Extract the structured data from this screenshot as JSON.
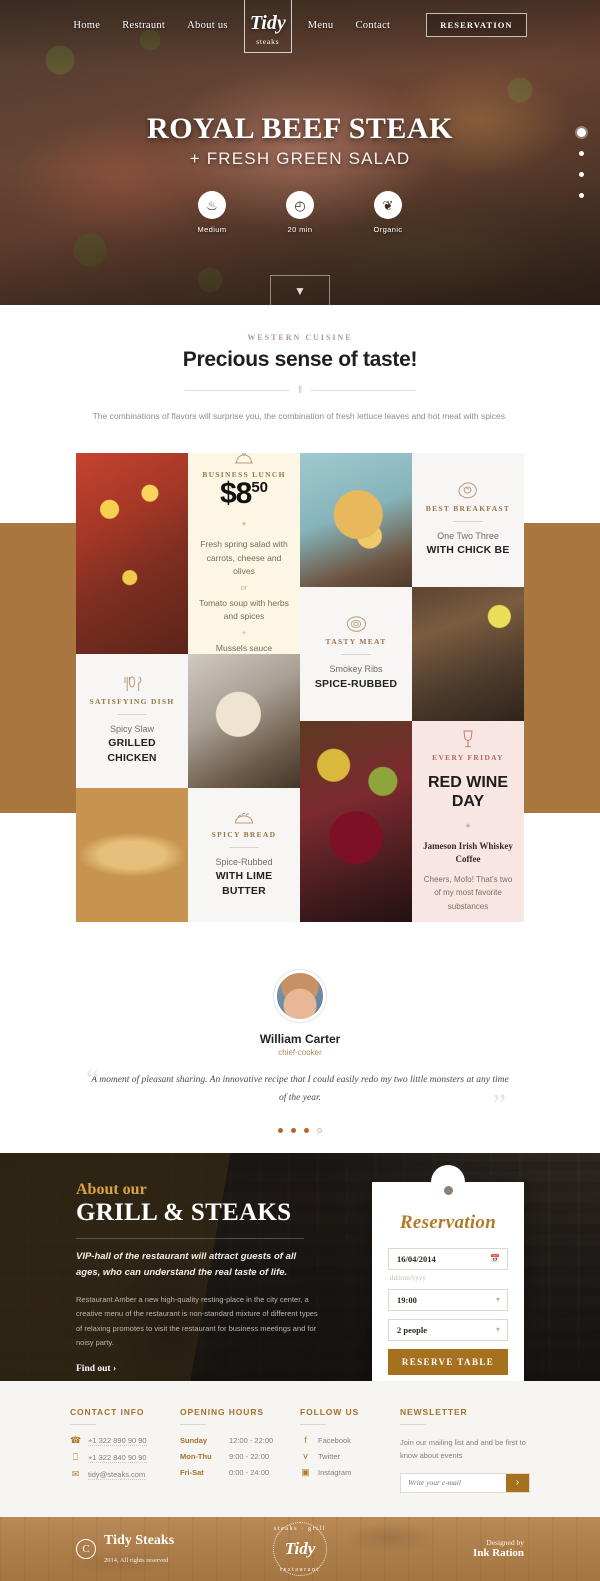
{
  "nav": {
    "left_links": [
      {
        "label": "Home"
      },
      {
        "label": "Restraunt"
      },
      {
        "label": "About us"
      }
    ],
    "right_links": [
      {
        "label": "Menu"
      },
      {
        "label": "Contact"
      }
    ],
    "logo_mark": "Tidy",
    "logo_sub": "steaks",
    "reservation_button": "RESERVATION"
  },
  "hero": {
    "title": "ROYAL BEEF STEAK",
    "subtitle": "+ FRESH GREEN SALAD",
    "features": [
      {
        "icon": "flame-icon",
        "glyph": "♨",
        "label": "Medium"
      },
      {
        "icon": "clock-icon",
        "glyph": "◴",
        "label": "20 min"
      },
      {
        "icon": "leaf-icon",
        "glyph": "❦",
        "label": "Organic"
      }
    ],
    "slider_dots": 4,
    "active_dot": 1,
    "scroll_icon": "chevron-down-icon"
  },
  "intro": {
    "eyebrow": "WESTERN CUISINE",
    "heading": "Precious sense of taste!",
    "divider_glyph": "‖",
    "paragraph": "The combinations of flavors will surprise you, the combination of fresh lettuce leaves and hot meat with spices."
  },
  "menu_tiles": {
    "business_lunch": {
      "icon": "cloche-icon",
      "kicker": "BUSINESS LUNCH",
      "price_main": "$8",
      "price_cents": "50",
      "line1": "Fresh spring salad with carrots, cheese and olives",
      "sep1": "or",
      "line2": "Tomato soup with herbs and spices",
      "sep2": "+",
      "line3": "Mussels sauce"
    },
    "best_breakfast": {
      "icon": "fried-egg-icon",
      "kicker": "BEST BREAKFAST",
      "line1": "One Two Three",
      "line2": "WITH CHICK BE"
    },
    "tasty_meat": {
      "icon": "steak-icon",
      "kicker": "TASTY MEAT",
      "line1": "Smokey Ribs",
      "line2": "SPICE-RUBBED"
    },
    "satisfying_dish": {
      "icon": "cutlery-icon",
      "kicker": "SATISFYING DISH",
      "line1": "Spicy Slaw",
      "line2": "GRILLED CHICKEN"
    },
    "spicy_bread": {
      "icon": "bread-icon",
      "kicker": "SPICY BREAD",
      "line1": "Spice-Rubbed",
      "line2": "WITH LIME BUTTER"
    },
    "red_wine_day": {
      "icon": "wine-glass-icon",
      "kicker": "EVERY FRIDAY",
      "title": "RED WINE DAY",
      "sub": "Jameson Irish Whiskey Coffee",
      "note": "Cheers, Mofo! That's two of my most favorite substances"
    }
  },
  "testimonial": {
    "avatar": "avatar",
    "name": "William Carter",
    "role": "chief-cooker",
    "quote": "A moment of pleasant sharing. An innovative recipe that I could easily redo my two little monsters at any time of the year.",
    "dots": 4,
    "active_dot": 3
  },
  "about": {
    "kicker": "About our",
    "heading": "GRILL & STEAKS",
    "lead": "VIP-hall of the restaurant will attract guests of all ages, who can understand the real taste of life.",
    "body": "Restaurant Amber a new high-quality resting-place in the city center, a creative menu of the restaurant is non-standard mixture of different types of relaxing promotes to visit the restaurant for business meetings and for noisy party.",
    "cta": "Find out  ›"
  },
  "reservation": {
    "title": "Reservation",
    "date_value": "16/04/2014",
    "date_icon": "calendar-icon",
    "date_hint": "dd/mm/yyyy",
    "time_value": "19:00",
    "people_value": "2 people",
    "chevron_icon": "chevron-down-icon",
    "submit_label": "RESERVE TABLE"
  },
  "footer": {
    "contact": {
      "heading": "CONTACT INFO",
      "rows": [
        {
          "icon": "phone-icon",
          "glyph": "☎",
          "value": "+1 322 890 90 90"
        },
        {
          "icon": "mobile-icon",
          "glyph": "⎕",
          "value": "+1 322 840 90 90"
        },
        {
          "icon": "mail-icon",
          "glyph": "✉",
          "value": "tidy@steaks.com"
        }
      ]
    },
    "hours": {
      "heading": "OPENING HOURS",
      "rows": [
        {
          "day": "Sunday",
          "time": "12:00 - 22:00"
        },
        {
          "day": "Mon-Thu",
          "time": "9:00 - 22:00"
        },
        {
          "day": "Fri-Sat",
          "time": "0:00 - 24:00"
        }
      ]
    },
    "follow": {
      "heading": "FOLLOW US",
      "rows": [
        {
          "icon": "facebook-icon",
          "glyph": "f",
          "label": "Facebook"
        },
        {
          "icon": "twitter-icon",
          "glyph": "ᴠ",
          "label": "Twitter"
        },
        {
          "icon": "instagram-icon",
          "glyph": "▣",
          "label": "Instagram"
        }
      ]
    },
    "newsletter": {
      "heading": "NEWSLETTER",
      "text": "Join our mailing list and and be first to know about events",
      "placeholder": "Write your e-mail",
      "button_icon": "chevron-right-icon",
      "button_glyph": "›"
    }
  },
  "bottom": {
    "copyright_symbol": "C",
    "brand": "Tidy Steaks",
    "rights": "2014, All rights reserved",
    "badge_top": "steaks  ·  grill",
    "badge_core": "Tidy",
    "badge_bottom": "restaurant",
    "designed_by": "Designed by",
    "designer": "Ink Ration"
  },
  "colors": {
    "accent_gold": "#a5711f",
    "accent_light": "#b07a2a",
    "cream": "#fcf7e4",
    "pink": "#f7e6e3"
  }
}
